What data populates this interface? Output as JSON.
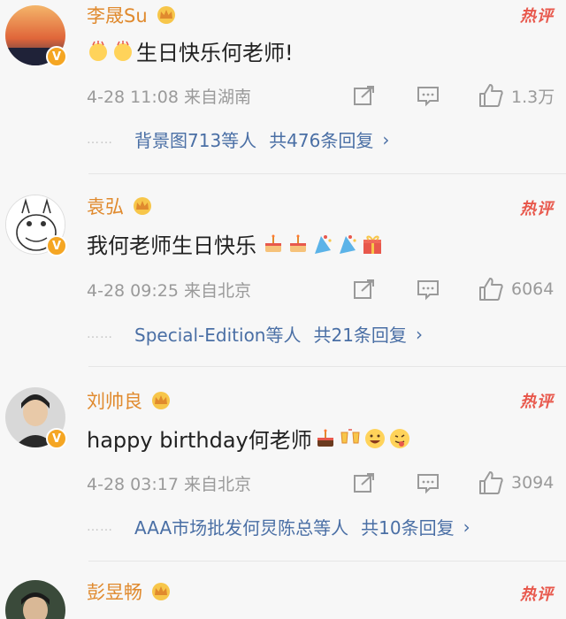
{
  "comments": [
    {
      "name": "李晟Su",
      "hot": "热评",
      "text": "生日快乐何老师!",
      "time": "4-28 11:08 来自湖南",
      "likes": "1.3万",
      "replies_users": "背景图713等人",
      "replies_count": "共476条回复",
      "emojis": [
        "clap-emoji",
        "clap-emoji"
      ]
    },
    {
      "name": "袁弘",
      "hot": "热评",
      "text": "我何老师生日快乐",
      "time": "4-28 09:25 来自北京",
      "likes": "6064",
      "replies_users": "Special-Edition等人",
      "replies_count": "共21条回复",
      "emojis": [
        "cake-emoji",
        "cake-emoji",
        "confetti-emoji",
        "confetti-emoji",
        "gift-emoji"
      ]
    },
    {
      "name": "刘帅良",
      "hot": "热评",
      "text": "happy birthday何老师",
      "time": "4-28 03:17 来自北京",
      "likes": "3094",
      "replies_users": "AAA市场批发何炅陈总等人",
      "replies_count": "共10条回复",
      "emojis": [
        "cake-emoji",
        "cheers-emoji",
        "laugh-emoji",
        "tongue-emoji"
      ]
    },
    {
      "name": "彭昱畅",
      "hot": "热评"
    }
  ],
  "icons": {
    "share": "share-icon",
    "comment": "comment-icon",
    "like": "thumbs-up-icon",
    "crown": "crown-badge-icon",
    "verified": "verified-v-icon"
  },
  "colors": {
    "name": "#e08a2e",
    "hot": "#e8584c",
    "link": "#4a6fa5",
    "meta": "#9a9a9a",
    "badge": "#f5a623"
  },
  "dots": "……",
  "chevron": "›",
  "badge_letter": "V"
}
